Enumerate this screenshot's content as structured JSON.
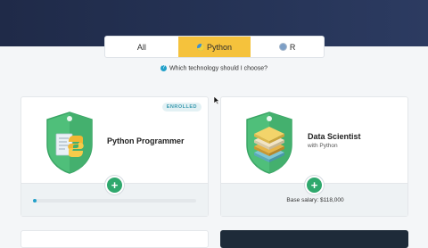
{
  "tabs": [
    {
      "label": "All",
      "active": false,
      "icon": ""
    },
    {
      "label": "Python",
      "active": true,
      "icon": "python-icon"
    },
    {
      "label": "R",
      "active": false,
      "icon": "r-icon"
    }
  ],
  "help_text": "Which technology should I choose?",
  "cards": [
    {
      "title": "Python Programmer",
      "badge": "ENROLLED",
      "progress": 0.02,
      "icon": "python-code-shield-icon"
    },
    {
      "title": "Data Scientist",
      "subtitle": "with Python",
      "salary": "Base salary: $118,000",
      "icon": "data-stack-shield-icon"
    }
  ],
  "colors": {
    "accent": "#f5c23c",
    "brand_green": "#2fa86d",
    "hero": "#1f2a48",
    "progress": "#22a0c9"
  }
}
